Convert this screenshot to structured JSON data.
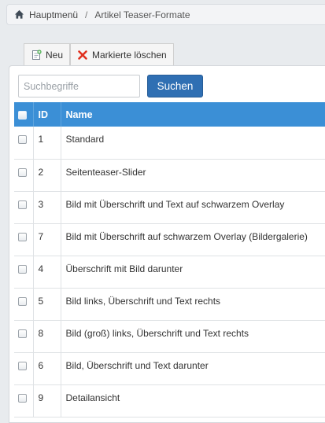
{
  "breadcrumb": {
    "home_icon": "home-icon",
    "home_label": "Hauptmenü",
    "separator": "/",
    "current": "Artikel Teaser-Formate"
  },
  "toolbar": {
    "new_label": "Neu",
    "new_icon": "new-document-icon",
    "delete_label": "Markierte löschen",
    "delete_icon": "red-x-icon",
    "delete_icon_color": "#e0301e"
  },
  "search": {
    "placeholder": "Suchbegriffe",
    "value": "",
    "button_label": "Suchen"
  },
  "colors": {
    "header_bg": "#3b8fd6",
    "button_bg": "#2f6fb3"
  },
  "table": {
    "headers": {
      "id": "ID",
      "name": "Name"
    },
    "rows": [
      {
        "id": "1",
        "name": "Standard"
      },
      {
        "id": "2",
        "name": "Seitenteaser-Slider"
      },
      {
        "id": "3",
        "name": "Bild mit Überschrift und Text auf schwarzem Overlay"
      },
      {
        "id": "7",
        "name": "Bild mit Überschrift auf schwarzem Overlay (Bildergalerie)"
      },
      {
        "id": "4",
        "name": "Überschrift mit Bild darunter"
      },
      {
        "id": "5",
        "name": "Bild links, Überschrift und Text rechts"
      },
      {
        "id": "8",
        "name": "Bild (groß) links, Überschrift und Text rechts"
      },
      {
        "id": "6",
        "name": "Bild, Überschrift und Text darunter"
      },
      {
        "id": "9",
        "name": "Detailansicht"
      }
    ]
  }
}
